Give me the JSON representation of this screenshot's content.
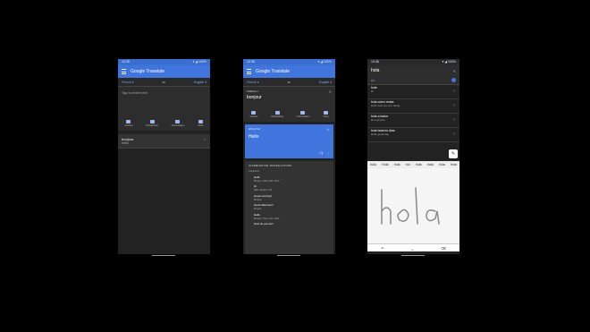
{
  "phone1": {
    "status_time": "10:38",
    "status_right": "▾ ◢ 100%",
    "app_title": "Google Translate",
    "lang_from": "French ▾",
    "lang_to": "English ▾",
    "input_placeholder": "Tap to enter text",
    "tools": [
      "Camera",
      "Handwriting",
      "Conversation",
      "Voice"
    ],
    "history": {
      "source": "bonjour",
      "translation": "Hello"
    }
  },
  "phone2": {
    "status_time": "10:38",
    "status_right": "▾ ◢ 100%",
    "app_title": "Google Translate",
    "lang_from": "French ▾",
    "lang_to": "English ▾",
    "source_lang": "FRENCH",
    "source_text": "bonjour",
    "tools": [
      "Camera",
      "Handwriting",
      "Conversation",
      "Voice"
    ],
    "result_lang": "ENGLISH",
    "result_text": "Hello",
    "alt_title": "ALTERNATIVE TRANSLATIONS",
    "alt_sub": "interjection",
    "alternatives": [
      {
        "word": "Hello",
        "syn": "Bonjour, Salut, Allô, Tiens"
      },
      {
        "word": "Hi",
        "syn": "Salut, Bonjour, Hé"
      },
      {
        "word": "Good morning!",
        "syn": "Bonjour"
      },
      {
        "word": "Good afternoon!",
        "syn": "Bonjour"
      },
      {
        "word": "Hallo",
        "syn": "Bonjour, Tiens, Allô, Salut"
      },
      {
        "word": "How do you do?",
        "syn": ""
      }
    ]
  },
  "phone3": {
    "status_time": "10:38",
    "status_right": "▾ ◢ 100%",
    "search_text": "hola",
    "lang_label": "EN",
    "suggestions": [
      {
        "a": "hola",
        "b": "Hi"
      },
      {
        "a": "hola cómo estas",
        "b": "Hello how are you doing"
      },
      {
        "a": "hola a todos",
        "b": "Hi everyone"
      },
      {
        "a": "hola buenos días",
        "b": "Hello good day"
      }
    ],
    "candidates": [
      "hola",
      "Hola",
      "hoia",
      "hol",
      "hola",
      "hala",
      "hola",
      "hola"
    ],
    "handwriting": "hola"
  }
}
